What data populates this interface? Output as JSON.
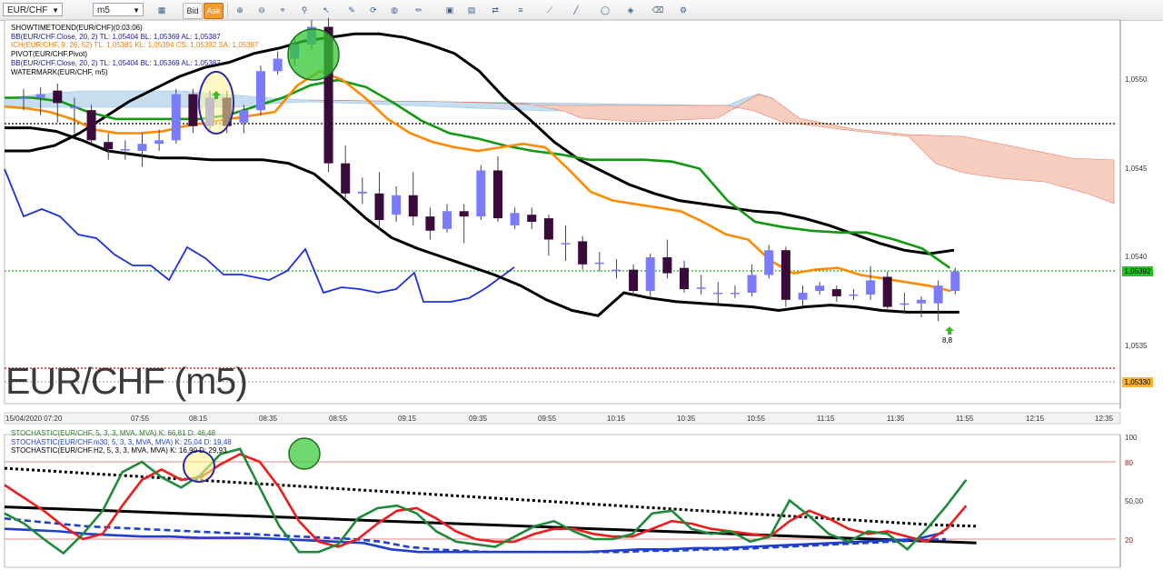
{
  "toolbar": {
    "symbol": "EUR/CHF",
    "timeframe": "m5",
    "bid_label": "Bid",
    "ask_label": "Ask",
    "icons": [
      "cursor-icon",
      "chart-type-icon",
      "zoom-in-icon",
      "zoom-out-icon",
      "crosshair-icon",
      "edit-icon",
      "refresh-icon",
      "globe-icon",
      "pencil-icon",
      "screenshot-icon",
      "window-icon",
      "arrows-icon",
      "lines-icon",
      "fib-icon",
      "trend-icon",
      "ellipse-icon",
      "shapes-icon",
      "eraser-icon",
      "objects-icon"
    ]
  },
  "main_legend": [
    {
      "text": "SHOWTIMETOEND(EUR/CHF)(0:03:06)",
      "color": "#000000"
    },
    {
      "text": "BB(EUR/CHF.Close, 20, 2)  TL: 1,05404  BL: 1,05369  AL: 1,05387",
      "color": "#1a1a9a"
    },
    {
      "text": "ICH(EUR/CHF, 9, 26, 52)  TL: 1,05381  KL: 1,05394  CS: 1,05392  SA: 1,05387",
      "color": "#ee7f0f"
    },
    {
      "text": "PIVOT(EUR/CHF.Pivot)",
      "color": "#000000"
    },
    {
      "text": "BB(EUR/CHF.Close, 20, 2)  TL: 1,05404  BL: 1,05369  AL: 1,05387",
      "color": "#1a1a9a"
    },
    {
      "text": "WATERMARK(EUR/CHF, m5)",
      "color": "#000000"
    }
  ],
  "watermark": "EUR/CHF (m5)",
  "signal_label": "8,8",
  "current_price_tag": "1,05392",
  "pivot_price_tag": "1,05330",
  "price_axis": [
    "1,0550",
    "1,0545",
    "1,0540",
    "1,0535"
  ],
  "time_axis": [
    "15/04/2020 07:20",
    "07:55",
    "08:15",
    "08:35",
    "08:55",
    "09:15",
    "09:35",
    "09:55",
    "10:15",
    "10:35",
    "10:55",
    "11:15",
    "11:35",
    "11:55",
    "12:15",
    "12:35"
  ],
  "stoch_legend": [
    {
      "text": "STOCHASTIC(EUR/CHF, 5, 3, 3, MVA, MVA)  K: 66,81  D: 46,48",
      "color": "#2e7d32"
    },
    {
      "text": "STOCHASTIC(EUR/CHF.m30, 5, 3, 3, MVA, MVA)  K: 25,04  D: 19,48",
      "color": "#1f3fd0"
    },
    {
      "text": "STOCHASTIC(EUR/CHF.H2, 5, 3, 3, MVA, MVA)  K: 16,90  D: 29,93",
      "color": "#000000"
    }
  ],
  "stoch_axis": [
    "100",
    "80",
    "50,00",
    "20"
  ],
  "colors": {
    "bull": "#7b7bff",
    "bear": "#3a0a3a",
    "ich_tenkan": "#ff8a00",
    "ich_kijun": "#119911",
    "bb": "#000000",
    "chikou": "#1f2fe0",
    "cloud_bull": "#c5def0",
    "cloud_bear": "#f6cdbf",
    "current_price": "#1ab81a",
    "pivot": "#cc0000"
  },
  "chart_data": {
    "type": "candlestick",
    "symbol": "EUR/CHF",
    "timeframe": "m5",
    "candles": [
      {
        "time": "07:20",
        "open": 1.0549,
        "close": 1.0549,
        "high": 1.05495,
        "low": 1.05483
      },
      {
        "time": "07:25",
        "open": 1.0549,
        "close": 1.05492,
        "high": 1.05496,
        "low": 1.0548
      },
      {
        "time": "07:30",
        "open": 1.05494,
        "close": 1.05487,
        "high": 1.05498,
        "low": 1.05476
      },
      {
        "time": "07:35",
        "open": 1.05484,
        "close": 1.05485,
        "high": 1.0549,
        "low": 1.0547
      },
      {
        "time": "07:40",
        "open": 1.05483,
        "close": 1.05466,
        "high": 1.05486,
        "low": 1.05464
      },
      {
        "time": "07:45",
        "open": 1.05465,
        "close": 1.05461,
        "high": 1.0547,
        "low": 1.05455
      },
      {
        "time": "07:50",
        "open": 1.05461,
        "close": 1.05461,
        "high": 1.05466,
        "low": 1.05455
      },
      {
        "time": "07:55",
        "open": 1.0546,
        "close": 1.05464,
        "high": 1.0547,
        "low": 1.05451
      },
      {
        "time": "08:00",
        "open": 1.05464,
        "close": 1.05466,
        "high": 1.05472,
        "low": 1.0546
      },
      {
        "time": "08:05",
        "open": 1.05466,
        "close": 1.05492,
        "high": 1.05495,
        "low": 1.05464
      },
      {
        "time": "08:10",
        "open": 1.05492,
        "close": 1.05474,
        "high": 1.05495,
        "low": 1.0547
      },
      {
        "time": "08:15",
        "open": 1.05474,
        "close": 1.0549,
        "high": 1.05494,
        "low": 1.05472
      },
      {
        "time": "08:20",
        "open": 1.0549,
        "close": 1.05474,
        "high": 1.05494,
        "low": 1.0547
      },
      {
        "time": "08:25",
        "open": 1.05476,
        "close": 1.05483,
        "high": 1.05486,
        "low": 1.0547
      },
      {
        "time": "08:30",
        "open": 1.05483,
        "close": 1.05505,
        "high": 1.05508,
        "low": 1.0548
      },
      {
        "time": "08:35",
        "open": 1.05505,
        "close": 1.05512,
        "high": 1.05516,
        "low": 1.05503
      },
      {
        "time": "08:40",
        "open": 1.05512,
        "close": 1.0552,
        "high": 1.05524,
        "low": 1.05508
      },
      {
        "time": "08:45",
        "open": 1.0552,
        "close": 1.0553,
        "high": 1.05534,
        "low": 1.05517
      },
      {
        "time": "08:50",
        "open": 1.0553,
        "close": 1.05453,
        "high": 1.05535,
        "low": 1.05448
      },
      {
        "time": "08:55",
        "open": 1.05453,
        "close": 1.05436,
        "high": 1.05463,
        "low": 1.05432
      },
      {
        "time": "09:00",
        "open": 1.05436,
        "close": 1.05437,
        "high": 1.05445,
        "low": 1.0543
      },
      {
        "time": "09:05",
        "open": 1.05436,
        "close": 1.05421,
        "high": 1.05448,
        "low": 1.05416
      },
      {
        "time": "09:10",
        "open": 1.05424,
        "close": 1.05435,
        "high": 1.0544,
        "low": 1.0542
      },
      {
        "time": "09:15",
        "open": 1.05435,
        "close": 1.05423,
        "high": 1.05448,
        "low": 1.05418
      },
      {
        "time": "09:20",
        "open": 1.05423,
        "close": 1.05415,
        "high": 1.05428,
        "low": 1.0541
      },
      {
        "time": "09:25",
        "open": 1.05416,
        "close": 1.05426,
        "high": 1.0543,
        "low": 1.05414
      },
      {
        "time": "09:30",
        "open": 1.05426,
        "close": 1.05423,
        "high": 1.0543,
        "low": 1.05408
      },
      {
        "time": "09:35",
        "open": 1.05423,
        "close": 1.05449,
        "high": 1.05452,
        "low": 1.05421
      },
      {
        "time": "09:40",
        "open": 1.05449,
        "close": 1.05422,
        "high": 1.05457,
        "low": 1.0542
      },
      {
        "time": "09:45",
        "open": 1.05418,
        "close": 1.05425,
        "high": 1.05428,
        "low": 1.05416
      },
      {
        "time": "09:50",
        "open": 1.05424,
        "close": 1.0542,
        "high": 1.05428,
        "low": 1.05416
      },
      {
        "time": "09:55",
        "open": 1.05422,
        "close": 1.0541,
        "high": 1.05424,
        "low": 1.05401
      },
      {
        "time": "10:00",
        "open": 1.05408,
        "close": 1.05408,
        "high": 1.05418,
        "low": 1.05398
      },
      {
        "time": "10:05",
        "open": 1.05409,
        "close": 1.05396,
        "high": 1.05412,
        "low": 1.05393
      },
      {
        "time": "10:10",
        "open": 1.05397,
        "close": 1.05397,
        "high": 1.05403,
        "low": 1.05392
      },
      {
        "time": "10:15",
        "open": 1.05393,
        "close": 1.05393,
        "high": 1.05399,
        "low": 1.05388
      },
      {
        "time": "10:20",
        "open": 1.05393,
        "close": 1.05381,
        "high": 1.05396,
        "low": 1.05378
      },
      {
        "time": "10:25",
        "open": 1.05381,
        "close": 1.054,
        "high": 1.05402,
        "low": 1.05378
      },
      {
        "time": "10:30",
        "open": 1.054,
        "close": 1.05391,
        "high": 1.0541,
        "low": 1.05388
      },
      {
        "time": "10:35",
        "open": 1.05394,
        "close": 1.05382,
        "high": 1.05398,
        "low": 1.0538
      },
      {
        "time": "10:40",
        "open": 1.05383,
        "close": 1.05383,
        "high": 1.0539,
        "low": 1.05379
      },
      {
        "time": "10:45",
        "open": 1.0538,
        "close": 1.0538,
        "high": 1.05386,
        "low": 1.05374
      },
      {
        "time": "10:50",
        "open": 1.0538,
        "close": 1.0538,
        "high": 1.05384,
        "low": 1.05377
      },
      {
        "time": "10:55",
        "open": 1.0538,
        "close": 1.0539,
        "high": 1.05396,
        "low": 1.05378
      },
      {
        "time": "11:00",
        "open": 1.0539,
        "close": 1.05404,
        "high": 1.05407,
        "low": 1.05388
      },
      {
        "time": "11:05",
        "open": 1.05404,
        "close": 1.05376,
        "high": 1.05406,
        "low": 1.05372
      },
      {
        "time": "11:10",
        "open": 1.05376,
        "close": 1.0538,
        "high": 1.05384,
        "low": 1.05372
      },
      {
        "time": "11:15",
        "open": 1.05381,
        "close": 1.05384,
        "high": 1.05386,
        "low": 1.05379
      },
      {
        "time": "11:20",
        "open": 1.05382,
        "close": 1.05378,
        "high": 1.05384,
        "low": 1.05375
      },
      {
        "time": "11:25",
        "open": 1.05379,
        "close": 1.05379,
        "high": 1.05382,
        "low": 1.05376
      },
      {
        "time": "11:30",
        "open": 1.05379,
        "close": 1.05387,
        "high": 1.05395,
        "low": 1.05376
      },
      {
        "time": "11:35",
        "open": 1.05389,
        "close": 1.05372,
        "high": 1.05392,
        "low": 1.05371
      },
      {
        "time": "11:40",
        "open": 1.05374,
        "close": 1.05374,
        "high": 1.0538,
        "low": 1.05368
      },
      {
        "time": "11:45",
        "open": 1.05374,
        "close": 1.05376,
        "high": 1.05378,
        "low": 1.05366
      },
      {
        "time": "11:50",
        "open": 1.05374,
        "close": 1.05384,
        "high": 1.05387,
        "low": 1.05364
      },
      {
        "time": "11:55",
        "open": 1.05381,
        "close": 1.05392,
        "high": 1.05394,
        "low": 1.05379
      }
    ],
    "bb_upper": [
      1.0546,
      1.0546,
      1.05463,
      1.0547,
      1.05479,
      1.05488,
      1.05495,
      1.05502,
      1.05507,
      1.0551,
      1.05515,
      1.05518,
      1.05522,
      1.05524,
      1.05526,
      1.05526,
      1.05524,
      1.0552,
      1.05515,
      1.05505,
      1.0549,
      1.05478,
      1.05465,
      1.05455,
      1.05448,
      1.05441,
      1.05436,
      1.05432,
      1.0543,
      1.05428,
      1.05426,
      1.05425,
      1.05422,
      1.05418,
      1.05413,
      1.05408,
      1.05404,
      1.05402,
      1.05404
    ],
    "bb_lower": [
      1.05473,
      1.05473,
      1.05471,
      1.05466,
      1.0546,
      1.05458,
      1.05456,
      1.05456,
      1.05455,
      1.05455,
      1.05455,
      1.05453,
      1.05447,
      1.05435,
      1.05422,
      1.05411,
      1.05405,
      1.054,
      1.05395,
      1.0539,
      1.05384,
      1.05376,
      1.0537,
      1.05367,
      1.0538,
      1.05377,
      1.05375,
      1.05374,
      1.05373,
      1.05372,
      1.0537,
      1.05372,
      1.05373,
      1.05372,
      1.0537,
      1.05369,
      1.05369,
      1.05369
    ],
    "ichimoku_tenkan": [
      1.05485,
      1.05484,
      1.05482,
      1.05478,
      1.05472,
      1.0547,
      1.0547,
      1.05471,
      1.05474,
      1.05476,
      1.05478,
      1.0548,
      1.05482,
      1.05497,
      1.05505,
      1.055,
      1.0549,
      1.05478,
      1.0547,
      1.05465,
      1.05462,
      1.0546,
      1.05462,
      1.05464,
      1.05462,
      1.0545,
      1.05437,
      1.05432,
      1.0543,
      1.05428,
      1.05426,
      1.0542,
      1.05413,
      1.0541,
      1.05398,
      1.05391,
      1.05393,
      1.05394,
      1.0539,
      1.05388,
      1.05386,
      1.05384,
      1.05381
    ],
    "ichimoku_kijun": [
      1.0549,
      1.0549,
      1.05488,
      1.05482,
      1.05478,
      1.05478,
      1.05478,
      1.05478,
      1.0548,
      1.05485,
      1.0549,
      1.05497,
      1.055,
      1.05496,
      1.05487,
      1.05477,
      1.0547,
      1.05467,
      1.05463,
      1.0546,
      1.05458,
      1.05455,
      1.05455,
      1.05455,
      1.05454,
      1.0545,
      1.05432,
      1.0542,
      1.05417,
      1.05415,
      1.05414,
      1.05414,
      1.0541,
      1.05405,
      1.05394
    ]
  },
  "stoch_data": {
    "ylim": [
      0,
      100
    ],
    "k_m5": [
      40,
      32,
      20,
      9,
      24,
      42,
      72,
      80,
      68,
      60,
      70,
      86,
      90,
      60,
      30,
      10,
      10,
      16,
      36,
      44,
      46,
      40,
      26,
      18,
      16,
      14,
      22,
      30,
      34,
      26,
      20,
      20,
      24,
      40,
      42,
      28,
      24,
      26,
      18,
      22,
      50,
      38,
      24,
      18,
      26,
      24,
      12,
      28,
      46,
      66
    ],
    "d_m5": [
      62,
      52,
      42,
      30,
      20,
      24,
      46,
      66,
      74,
      66,
      68,
      78,
      86,
      80,
      60,
      34,
      18,
      14,
      20,
      32,
      42,
      44,
      36,
      26,
      20,
      18,
      18,
      24,
      28,
      28,
      24,
      22,
      22,
      28,
      34,
      32,
      28,
      26,
      24,
      22,
      34,
      42,
      36,
      28,
      24,
      26,
      22,
      18,
      28,
      46
    ],
    "k_m30": [
      28,
      27,
      26,
      24,
      23,
      22,
      22,
      21,
      21,
      21,
      20,
      19,
      18,
      17,
      12,
      10,
      10,
      10,
      10,
      10,
      10,
      10,
      11,
      12,
      12,
      13,
      13,
      14,
      15,
      16,
      17,
      18,
      19,
      20,
      25
    ],
    "d_m30": [
      36,
      34,
      32,
      30,
      29,
      28,
      27,
      26,
      25,
      24,
      23,
      22,
      21,
      20,
      18,
      14,
      12,
      11,
      10,
      10,
      10,
      10,
      10,
      10,
      11,
      11,
      12,
      12,
      13,
      14,
      15,
      16,
      17,
      18,
      19,
      20
    ],
    "k_h2": [
      45,
      44,
      43,
      42,
      41,
      40,
      39,
      38,
      37,
      36,
      35,
      34,
      33,
      32,
      31,
      30,
      29,
      28,
      27,
      26,
      25,
      24,
      23,
      22,
      21,
      20,
      19,
      18,
      17
    ],
    "d_h2": [
      75,
      73,
      71,
      69,
      67,
      65,
      63,
      61,
      59,
      57,
      55,
      53,
      51,
      49,
      47,
      45,
      43,
      41,
      39,
      37,
      35,
      33,
      31,
      30
    ]
  }
}
